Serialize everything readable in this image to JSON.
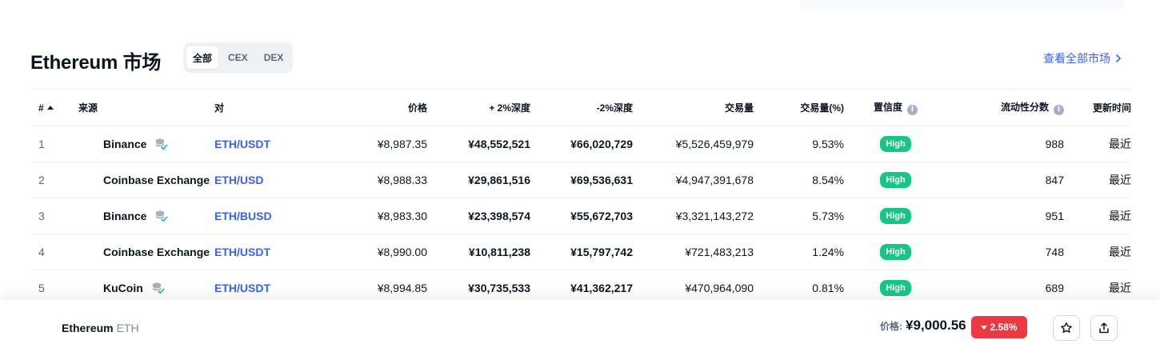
{
  "header": {
    "title": "Ethereum 市场",
    "filters": [
      "全部",
      "CEX",
      "DEX"
    ],
    "view_all": "查看全部市场"
  },
  "table": {
    "columns": {
      "rank": "#",
      "source": "来源",
      "pair": "对",
      "price": "价格",
      "depth_plus": "+ 2%深度",
      "depth_minus": "-2%深度",
      "volume": "交易量",
      "volume_pct": "交易量(%)",
      "confidence": "置信度",
      "liquidity": "流动性分数",
      "updated": "更新时间"
    },
    "rows": [
      {
        "rank": "1",
        "source": "Binance",
        "verified": true,
        "pair": "ETH/USDT",
        "price": "¥8,987.35",
        "depth_plus": "¥48,552,521",
        "depth_minus": "¥66,020,729",
        "volume": "¥5,526,459,979",
        "volume_pct": "9.53%",
        "confidence": "High",
        "liquidity": "988",
        "updated": "最近"
      },
      {
        "rank": "2",
        "source": "Coinbase Exchange",
        "verified": false,
        "pair": "ETH/USD",
        "price": "¥8,988.33",
        "depth_plus": "¥29,861,516",
        "depth_minus": "¥69,536,631",
        "volume": "¥4,947,391,678",
        "volume_pct": "8.54%",
        "confidence": "High",
        "liquidity": "847",
        "updated": "最近"
      },
      {
        "rank": "3",
        "source": "Binance",
        "verified": true,
        "pair": "ETH/BUSD",
        "price": "¥8,983.30",
        "depth_plus": "¥23,398,574",
        "depth_minus": "¥55,672,703",
        "volume": "¥3,321,143,272",
        "volume_pct": "5.73%",
        "confidence": "High",
        "liquidity": "951",
        "updated": "最近"
      },
      {
        "rank": "4",
        "source": "Coinbase Exchange",
        "verified": false,
        "pair": "ETH/USDT",
        "price": "¥8,990.00",
        "depth_plus": "¥10,811,238",
        "depth_minus": "¥15,797,742",
        "volume": "¥721,483,213",
        "volume_pct": "1.24%",
        "confidence": "High",
        "liquidity": "748",
        "updated": "最近"
      },
      {
        "rank": "5",
        "source": "KuCoin",
        "verified": true,
        "pair": "ETH/USDT",
        "price": "¥8,994.85",
        "depth_plus": "¥30,735,533",
        "depth_minus": "¥41,362,217",
        "volume": "¥470,964,090",
        "volume_pct": "0.81%",
        "confidence": "High",
        "liquidity": "689",
        "updated": "最近"
      }
    ]
  },
  "bottom_bar": {
    "coin_name": "Ethereum",
    "coin_symbol": "ETH",
    "price_label": "价格:",
    "price": "¥9,000.56",
    "change": "2.58%"
  },
  "colors": {
    "accent": "#3861fb",
    "high": "#16c784",
    "negative": "#ea3943"
  },
  "icons": {
    "verified": "database-check-icon",
    "info": "info-icon",
    "star": "star-icon",
    "share": "share-icon",
    "chevron": "chevron-right-icon"
  }
}
